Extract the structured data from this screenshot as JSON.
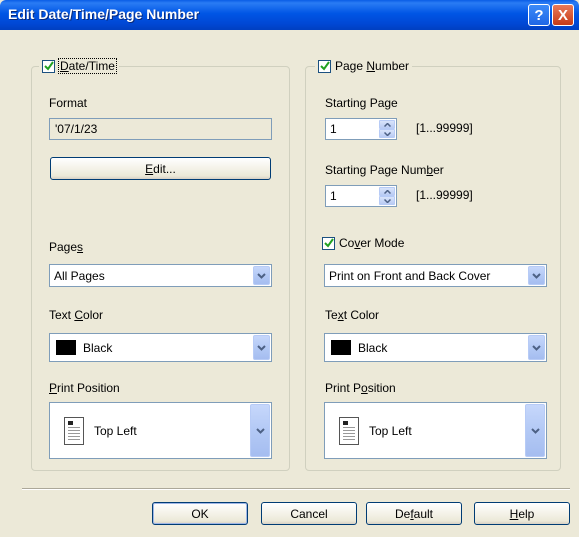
{
  "window": {
    "title": "Edit Date/Time/Page Number",
    "help_glyph": "?",
    "close_glyph": "X"
  },
  "date_time": {
    "checkbox_label_pre": "",
    "checkbox_label_ul": "D",
    "checkbox_label_post": "ate/Time",
    "checked": true,
    "format_label": "Format",
    "format_value": "'07/1/23",
    "edit_button_ul": "E",
    "edit_button_post": "dit...",
    "pages_label_pre": "Page",
    "pages_label_ul": "s",
    "pages_value": "All Pages",
    "text_color_label_pre": "Text ",
    "text_color_label_ul": "C",
    "text_color_label_post": "olor",
    "text_color_value": "Black",
    "print_position_label_ul": "P",
    "print_position_label_post": "rint Position",
    "print_position_value": "Top Left"
  },
  "page_number": {
    "checkbox_label_pre": "Page ",
    "checkbox_label_ul": "N",
    "checkbox_label_post": "umber",
    "checked": true,
    "starting_page_label": "Starting Page",
    "starting_page_value": "1",
    "starting_page_range": "[1...99999]",
    "starting_page_number_label_pre": "Starting Page Num",
    "starting_page_number_label_ul": "b",
    "starting_page_number_label_post": "er",
    "starting_page_number_value": "1",
    "starting_page_number_range": "[1...99999]",
    "cover_mode_label_pre": "Co",
    "cover_mode_label_ul": "v",
    "cover_mode_label_post": "er Mode",
    "cover_mode_checked": true,
    "cover_mode_value": "Print on Front and Back Cover",
    "text_color_label_pre": "Te",
    "text_color_label_ul": "x",
    "text_color_label_post": "t Color",
    "text_color_value": "Black",
    "print_position_label_pre": "Print P",
    "print_position_label_ul": "o",
    "print_position_label_post": "sition",
    "print_position_value": "Top Left"
  },
  "buttons": {
    "ok": "OK",
    "cancel": "Cancel",
    "default_pre": "De",
    "default_ul": "f",
    "default_post": "ault",
    "help_ul": "H",
    "help_post": "elp"
  },
  "colors": {
    "titlebar": "#0055e5",
    "dialog_bg": "#ece9d8",
    "checkmark": "#21a121",
    "swatch": "#000000"
  }
}
